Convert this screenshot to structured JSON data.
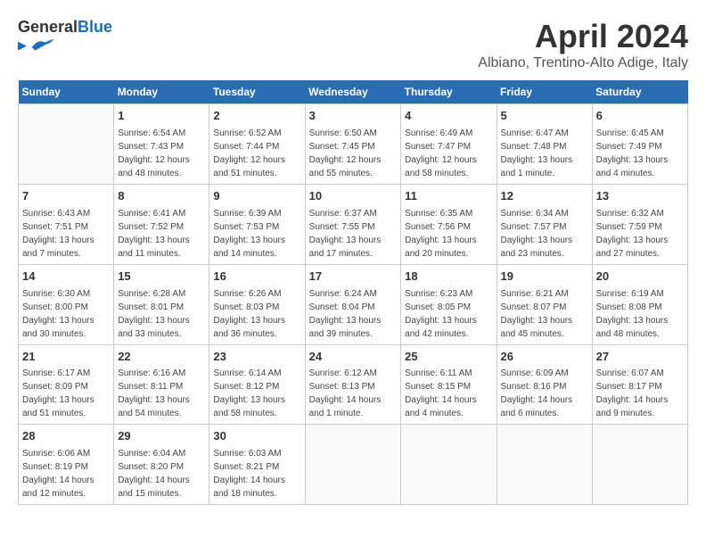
{
  "header": {
    "logo_general": "General",
    "logo_blue": "Blue",
    "month_title": "April 2024",
    "location": "Albiano, Trentino-Alto Adige, Italy"
  },
  "days_of_week": [
    "Sunday",
    "Monday",
    "Tuesday",
    "Wednesday",
    "Thursday",
    "Friday",
    "Saturday"
  ],
  "weeks": [
    [
      {
        "day": "",
        "sunrise": "",
        "sunset": "",
        "daylight": ""
      },
      {
        "day": "1",
        "sunrise": "Sunrise: 6:54 AM",
        "sunset": "Sunset: 7:43 PM",
        "daylight": "Daylight: 12 hours and 48 minutes."
      },
      {
        "day": "2",
        "sunrise": "Sunrise: 6:52 AM",
        "sunset": "Sunset: 7:44 PM",
        "daylight": "Daylight: 12 hours and 51 minutes."
      },
      {
        "day": "3",
        "sunrise": "Sunrise: 6:50 AM",
        "sunset": "Sunset: 7:45 PM",
        "daylight": "Daylight: 12 hours and 55 minutes."
      },
      {
        "day": "4",
        "sunrise": "Sunrise: 6:49 AM",
        "sunset": "Sunset: 7:47 PM",
        "daylight": "Daylight: 12 hours and 58 minutes."
      },
      {
        "day": "5",
        "sunrise": "Sunrise: 6:47 AM",
        "sunset": "Sunset: 7:48 PM",
        "daylight": "Daylight: 13 hours and 1 minute."
      },
      {
        "day": "6",
        "sunrise": "Sunrise: 6:45 AM",
        "sunset": "Sunset: 7:49 PM",
        "daylight": "Daylight: 13 hours and 4 minutes."
      }
    ],
    [
      {
        "day": "7",
        "sunrise": "Sunrise: 6:43 AM",
        "sunset": "Sunset: 7:51 PM",
        "daylight": "Daylight: 13 hours and 7 minutes."
      },
      {
        "day": "8",
        "sunrise": "Sunrise: 6:41 AM",
        "sunset": "Sunset: 7:52 PM",
        "daylight": "Daylight: 13 hours and 11 minutes."
      },
      {
        "day": "9",
        "sunrise": "Sunrise: 6:39 AM",
        "sunset": "Sunset: 7:53 PM",
        "daylight": "Daylight: 13 hours and 14 minutes."
      },
      {
        "day": "10",
        "sunrise": "Sunrise: 6:37 AM",
        "sunset": "Sunset: 7:55 PM",
        "daylight": "Daylight: 13 hours and 17 minutes."
      },
      {
        "day": "11",
        "sunrise": "Sunrise: 6:35 AM",
        "sunset": "Sunset: 7:56 PM",
        "daylight": "Daylight: 13 hours and 20 minutes."
      },
      {
        "day": "12",
        "sunrise": "Sunrise: 6:34 AM",
        "sunset": "Sunset: 7:57 PM",
        "daylight": "Daylight: 13 hours and 23 minutes."
      },
      {
        "day": "13",
        "sunrise": "Sunrise: 6:32 AM",
        "sunset": "Sunset: 7:59 PM",
        "daylight": "Daylight: 13 hours and 27 minutes."
      }
    ],
    [
      {
        "day": "14",
        "sunrise": "Sunrise: 6:30 AM",
        "sunset": "Sunset: 8:00 PM",
        "daylight": "Daylight: 13 hours and 30 minutes."
      },
      {
        "day": "15",
        "sunrise": "Sunrise: 6:28 AM",
        "sunset": "Sunset: 8:01 PM",
        "daylight": "Daylight: 13 hours and 33 minutes."
      },
      {
        "day": "16",
        "sunrise": "Sunrise: 6:26 AM",
        "sunset": "Sunset: 8:03 PM",
        "daylight": "Daylight: 13 hours and 36 minutes."
      },
      {
        "day": "17",
        "sunrise": "Sunrise: 6:24 AM",
        "sunset": "Sunset: 8:04 PM",
        "daylight": "Daylight: 13 hours and 39 minutes."
      },
      {
        "day": "18",
        "sunrise": "Sunrise: 6:23 AM",
        "sunset": "Sunset: 8:05 PM",
        "daylight": "Daylight: 13 hours and 42 minutes."
      },
      {
        "day": "19",
        "sunrise": "Sunrise: 6:21 AM",
        "sunset": "Sunset: 8:07 PM",
        "daylight": "Daylight: 13 hours and 45 minutes."
      },
      {
        "day": "20",
        "sunrise": "Sunrise: 6:19 AM",
        "sunset": "Sunset: 8:08 PM",
        "daylight": "Daylight: 13 hours and 48 minutes."
      }
    ],
    [
      {
        "day": "21",
        "sunrise": "Sunrise: 6:17 AM",
        "sunset": "Sunset: 8:09 PM",
        "daylight": "Daylight: 13 hours and 51 minutes."
      },
      {
        "day": "22",
        "sunrise": "Sunrise: 6:16 AM",
        "sunset": "Sunset: 8:11 PM",
        "daylight": "Daylight: 13 hours and 54 minutes."
      },
      {
        "day": "23",
        "sunrise": "Sunrise: 6:14 AM",
        "sunset": "Sunset: 8:12 PM",
        "daylight": "Daylight: 13 hours and 58 minutes."
      },
      {
        "day": "24",
        "sunrise": "Sunrise: 6:12 AM",
        "sunset": "Sunset: 8:13 PM",
        "daylight": "Daylight: 14 hours and 1 minute."
      },
      {
        "day": "25",
        "sunrise": "Sunrise: 6:11 AM",
        "sunset": "Sunset: 8:15 PM",
        "daylight": "Daylight: 14 hours and 4 minutes."
      },
      {
        "day": "26",
        "sunrise": "Sunrise: 6:09 AM",
        "sunset": "Sunset: 8:16 PM",
        "daylight": "Daylight: 14 hours and 6 minutes."
      },
      {
        "day": "27",
        "sunrise": "Sunrise: 6:07 AM",
        "sunset": "Sunset: 8:17 PM",
        "daylight": "Daylight: 14 hours and 9 minutes."
      }
    ],
    [
      {
        "day": "28",
        "sunrise": "Sunrise: 6:06 AM",
        "sunset": "Sunset: 8:19 PM",
        "daylight": "Daylight: 14 hours and 12 minutes."
      },
      {
        "day": "29",
        "sunrise": "Sunrise: 6:04 AM",
        "sunset": "Sunset: 8:20 PM",
        "daylight": "Daylight: 14 hours and 15 minutes."
      },
      {
        "day": "30",
        "sunrise": "Sunrise: 6:03 AM",
        "sunset": "Sunset: 8:21 PM",
        "daylight": "Daylight: 14 hours and 18 minutes."
      },
      {
        "day": "",
        "sunrise": "",
        "sunset": "",
        "daylight": ""
      },
      {
        "day": "",
        "sunrise": "",
        "sunset": "",
        "daylight": ""
      },
      {
        "day": "",
        "sunrise": "",
        "sunset": "",
        "daylight": ""
      },
      {
        "day": "",
        "sunrise": "",
        "sunset": "",
        "daylight": ""
      }
    ]
  ]
}
